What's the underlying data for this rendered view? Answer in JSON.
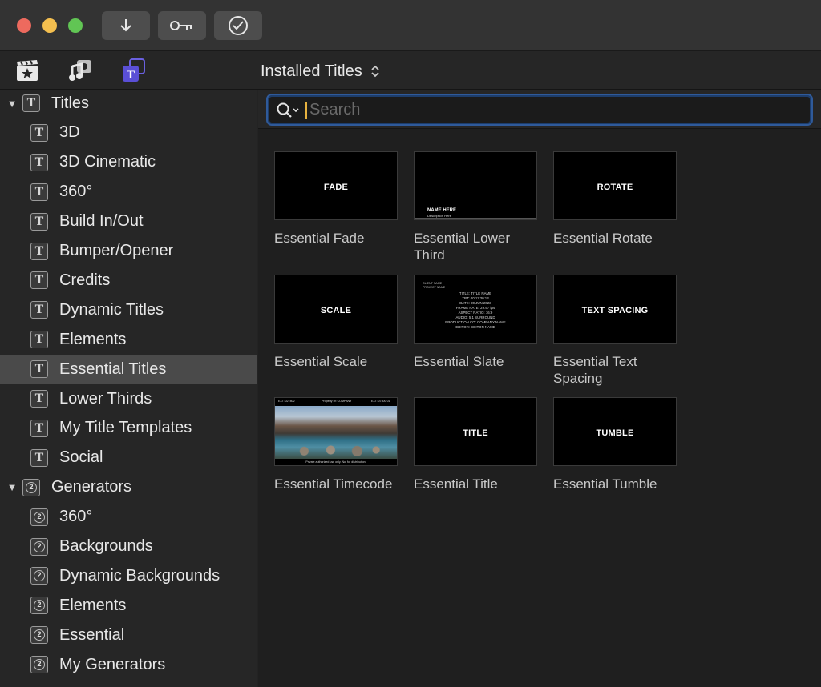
{
  "toolbar": {
    "buttons": [
      {
        "icon": "download-arrow-icon"
      },
      {
        "icon": "key-icon"
      },
      {
        "icon": "checkmark-circle-icon"
      }
    ]
  },
  "header": {
    "icons": [
      "clapper-star-icon",
      "music-camera-icon",
      "titles-generators-icon"
    ],
    "popup_label": "Installed Titles"
  },
  "sidebar": {
    "titles": {
      "label": "Titles",
      "items": [
        "3D",
        "3D Cinematic",
        "360°",
        "Build In/Out",
        "Bumper/Opener",
        "Credits",
        "Dynamic Titles",
        "Elements",
        "Essential Titles",
        "Lower Thirds",
        "My Title Templates",
        "Social"
      ]
    },
    "generators": {
      "label": "Generators",
      "items": [
        "360°",
        "Backgrounds",
        "Dynamic Backgrounds",
        "Elements",
        "Essential",
        "My Generators"
      ]
    },
    "selected": "Essential Titles",
    "title_icon_glyph": "T",
    "generator_icon_glyph": "2"
  },
  "search": {
    "placeholder": "Search",
    "value": ""
  },
  "grid": {
    "tiles": [
      {
        "name": "Essential Fade",
        "thumb_text": "FADE"
      },
      {
        "name": "Essential Lower Third",
        "thumb_text": "NAME HERE",
        "thumb_sub": "Description Here"
      },
      {
        "name": "Essential Rotate",
        "thumb_text": "ROTATE"
      },
      {
        "name": "Essential Scale",
        "thumb_text": "SCALE"
      },
      {
        "name": "Essential Slate",
        "thumb_lines": [
          "CLIENT NAME",
          "PROJECT NAME",
          "TITLE: TITLE NAME",
          "TRT: 00:11:30:13",
          "DATE: 20 JUN 2023",
          "FRAME RATE: 29.97 fps",
          "ASPECT RATIO: 16:9",
          "AUDIO: 5.1 SURROUND",
          "PRODUCTION CO: COMPANY NAME",
          "EDITOR: EDITOR NAME"
        ]
      },
      {
        "name": "Essential Text Spacing",
        "thumb_text": "TEXT SPACING"
      },
      {
        "name": "Essential Timecode",
        "thumb_top": [
          "EXT: 027802",
          "Property of: COMPANY",
          "EXT: 07300 01"
        ],
        "thumb_bottom": "Private authorized use only. Not for distribution."
      },
      {
        "name": "Essential Title",
        "thumb_text": "TITLE"
      },
      {
        "name": "Essential Tumble",
        "thumb_text": "TUMBLE"
      }
    ]
  },
  "colors": {
    "accent": "#2f5a9a",
    "caret": "#e7b23f",
    "selected_row": "#4a4a4a",
    "header_icon_active": "#5a4fd6"
  }
}
